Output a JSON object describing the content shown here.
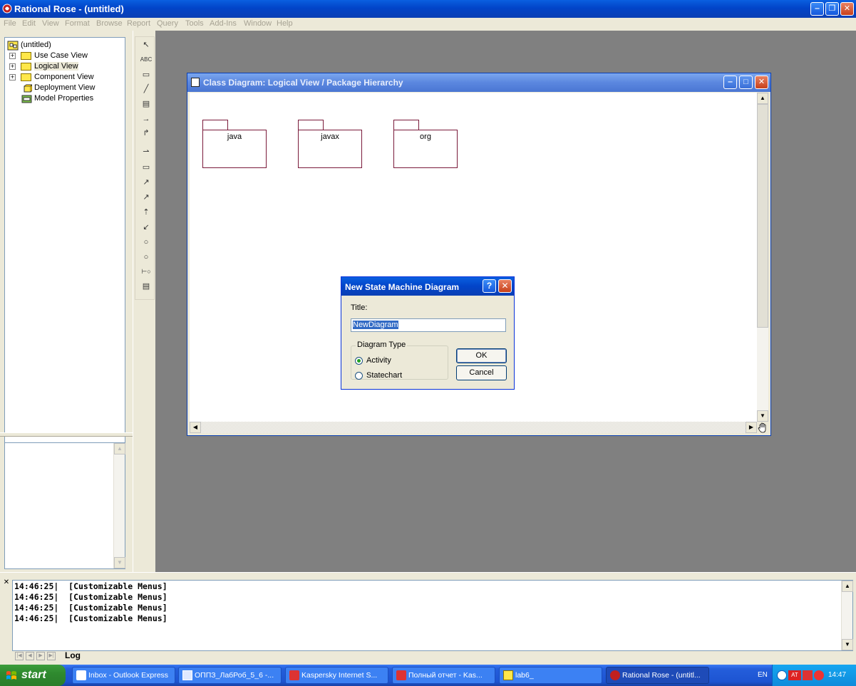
{
  "window": {
    "title": "Rational Rose - (untitled)",
    "minimize": "‒",
    "restore": "❐",
    "close": "✕"
  },
  "menu": [
    "File",
    "Edit",
    "View",
    "Format",
    "Browse",
    "Report",
    "Query",
    "Tools",
    "Add-Ins",
    "Window",
    "Help"
  ],
  "tree": {
    "root": "(untitled)",
    "items": [
      "Use Case View",
      "Logical View",
      "Component View",
      "Deployment View",
      "Model Properties"
    ]
  },
  "toolbox": {
    "tools": [
      "↖",
      "ABC",
      "▭",
      "╱",
      "▤",
      "→",
      "↱",
      "⇀",
      "▭",
      "↗",
      "↗",
      "⇡",
      "↙",
      "○",
      "○",
      "⊢○",
      "▤"
    ]
  },
  "diagram": {
    "title": "Class Diagram: Logical View / Package Hierarchy",
    "packages": [
      "java",
      "javax",
      "org"
    ]
  },
  "dialog": {
    "title": "New State Machine Diagram",
    "help": "?",
    "close": "✕",
    "title_label": "Title:",
    "title_value": "NewDiagram",
    "group_label": "Diagram Type",
    "options": [
      "Activity",
      "Statechart"
    ],
    "selected_option": "Activity",
    "ok": "OK",
    "cancel": "Cancel"
  },
  "log": {
    "lines": [
      "14:46:25|  [Customizable Menus]",
      "14:46:25|  [Customizable Menus]",
      "14:46:25|  [Customizable Menus]",
      "14:46:25|  [Customizable Menus]"
    ],
    "tab": "Log"
  },
  "taskbar": {
    "start": "start",
    "tasks": [
      "Inbox - Outlook Express",
      "ОППЗ_ЛабРоб_5_6 -...",
      "Kaspersky Internet S...",
      "Полный отчет - Kas...",
      "lab6_",
      "Rational Rose - (untitl..."
    ],
    "language": "EN",
    "clock": "14:47"
  },
  "colors": {
    "titlebar": "#0244c8",
    "package_border": "#7a1a3a",
    "selection": "#316ac5",
    "mdi_background": "#808080"
  }
}
